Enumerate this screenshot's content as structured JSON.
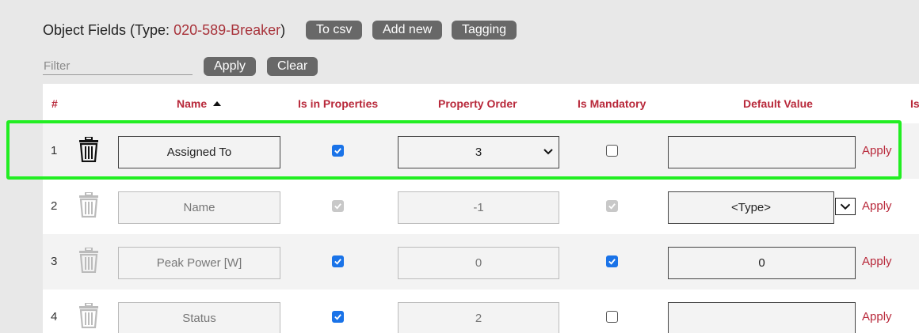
{
  "header": {
    "title_prefix": "Object Fields (Type: ",
    "type_name": "020-589-Breaker",
    "title_suffix": ")",
    "buttons": {
      "to_csv": "To csv",
      "add_new": "Add new",
      "tagging": "Tagging"
    }
  },
  "filter": {
    "placeholder": "Filter",
    "value": "",
    "apply_label": "Apply",
    "clear_label": "Clear"
  },
  "table": {
    "columns": {
      "num": "#",
      "name": "Name",
      "in_props": "Is in Properties",
      "order": "Property Order",
      "mandatory": "Is Mandatory",
      "default": "Default Value",
      "extra": "Is"
    },
    "sort": {
      "column": "Name",
      "direction": "ascending"
    },
    "rows": [
      {
        "num": "1",
        "name": "Assigned To",
        "in_properties": true,
        "order": "3",
        "mandatory": false,
        "default": "",
        "apply": "Apply",
        "editable": true
      },
      {
        "num": "2",
        "name": "Name",
        "in_properties": true,
        "order": "-1",
        "mandatory": true,
        "default": "<Type>",
        "apply": "Apply",
        "editable": false
      },
      {
        "num": "3",
        "name": "Peak Power [W]",
        "in_properties": true,
        "order": "0",
        "mandatory": true,
        "default": "0",
        "apply": "Apply",
        "editable": false
      },
      {
        "num": "4",
        "name": "Status",
        "in_properties": true,
        "order": "2",
        "mandatory": false,
        "default": "",
        "apply": "Apply",
        "editable": false
      }
    ]
  },
  "colors": {
    "accent": "#b8283a",
    "button_bg": "#686868",
    "highlight": "#22ee22",
    "checkbox": "#1a73e8"
  }
}
